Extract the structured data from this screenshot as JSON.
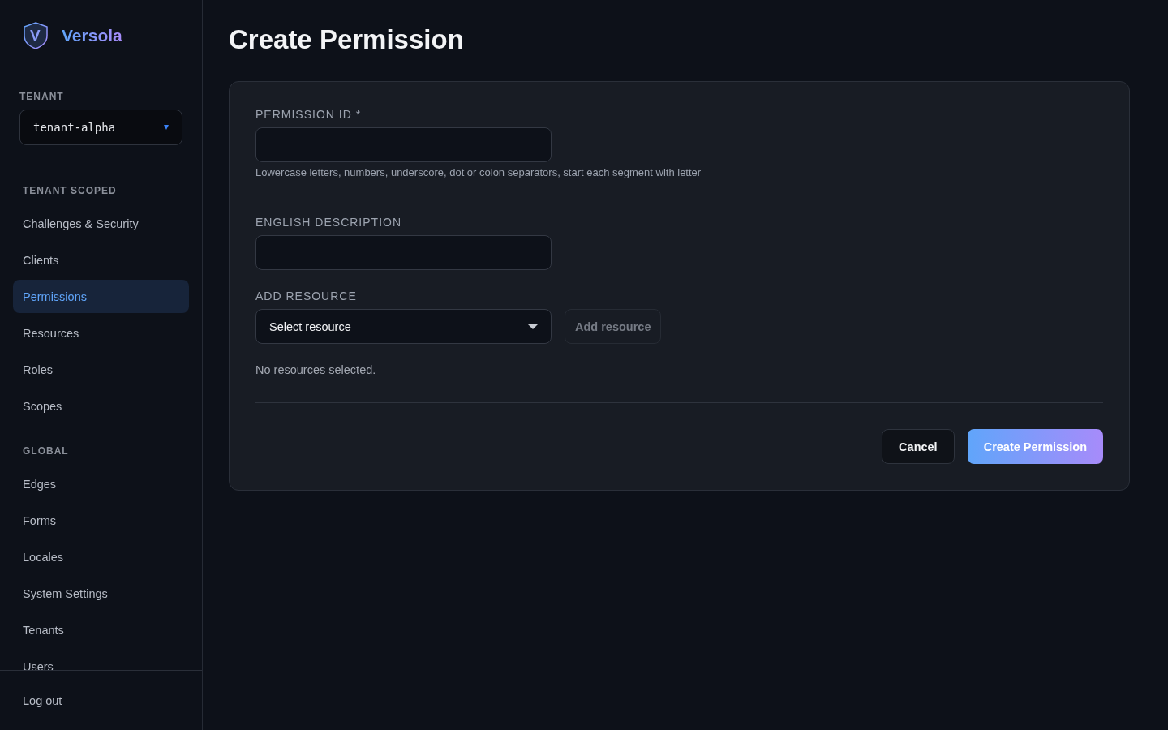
{
  "brand": {
    "name": "Versola",
    "logo_letter": "V"
  },
  "tenant": {
    "label": "TENANT",
    "value": "tenant-alpha"
  },
  "nav_sections": [
    {
      "title": "TENANT SCOPED",
      "items": [
        {
          "label": "Challenges & Security",
          "selected": false
        },
        {
          "label": "Clients",
          "selected": false
        },
        {
          "label": "Permissions",
          "selected": true
        },
        {
          "label": "Resources",
          "selected": false
        },
        {
          "label": "Roles",
          "selected": false
        },
        {
          "label": "Scopes",
          "selected": false
        }
      ]
    },
    {
      "title": "GLOBAL",
      "items": [
        {
          "label": "Edges",
          "selected": false
        },
        {
          "label": "Forms",
          "selected": false
        },
        {
          "label": "Locales",
          "selected": false
        },
        {
          "label": "System Settings",
          "selected": false
        },
        {
          "label": "Tenants",
          "selected": false
        },
        {
          "label": "Users",
          "selected": false
        }
      ]
    }
  ],
  "logout": "Log out",
  "page_title": "Create Permission",
  "form": {
    "permission_id": {
      "label": "PERMISSION ID *",
      "hint": "Lowercase letters, numbers, underscore, dot or colon separators, start each segment with letter"
    },
    "description": {
      "label": "ENGLISH DESCRIPTION"
    },
    "resource": {
      "label": "ADD RESOURCE",
      "select_placeholder": "Select resource",
      "add_button": {
        "label": "Add resource",
        "disabled": true
      },
      "empty_text": "No resources selected."
    },
    "buttons": [
      {
        "label": "Cancel",
        "kind": "secondary"
      },
      {
        "label": "Create Permission",
        "kind": "primary"
      }
    ]
  }
}
